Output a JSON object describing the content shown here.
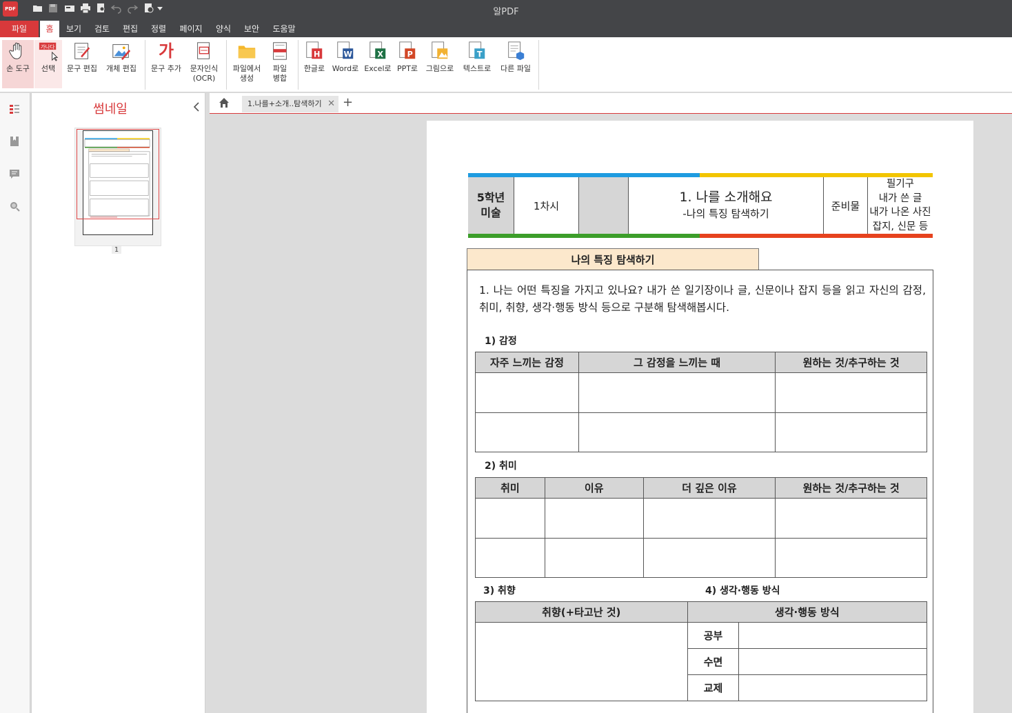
{
  "app": {
    "logo": "PDF",
    "title": "알PDF"
  },
  "menu": [
    "파일",
    "홈",
    "보기",
    "검토",
    "편집",
    "정렬",
    "페이지",
    "양식",
    "보안",
    "도움말"
  ],
  "ribbon": {
    "hand": "손 도구",
    "select": "선택",
    "select_badge": "가나다",
    "text_edit": "문구 편집",
    "object_edit": "개체 편집",
    "text_add": "문구 추가",
    "text_add_glyph": "가",
    "ocr": "문자인식",
    "ocr2": "(OCR)",
    "create": "파일에서",
    "create2": "생성",
    "merge": "파일",
    "merge2": "병합",
    "hangul": "한글로",
    "word": "Word로",
    "excel": "Excel로",
    "ppt": "PPT로",
    "image": "그림으로",
    "text": "텍스트로",
    "other": "다른 파일"
  },
  "thumbnails": {
    "title": "썸네일",
    "page_number": "1"
  },
  "tabs": {
    "doc_tab": "1.나를+소개..탐색하기",
    "close": "✕",
    "add": "+"
  },
  "doc": {
    "header": {
      "grade": "5학년",
      "subject": "미술",
      "period": "1차시",
      "title": "1. 나를 소개해요",
      "subtitle": "-나의 특징 탐색하기",
      "materials_label": "준비물",
      "materials": [
        "필기구",
        "내가 쓴 글",
        "내가 나온 사진",
        "잡지, 신문 등"
      ]
    },
    "section_title": "나의 특징 탐색하기",
    "question": "1. 나는 어떤 특징을 가지고 있나요? 내가 쓴 일기장이나 글, 신문이나 잡지 등을 읽고 자신의 감정, 취미, 취향, 생각·행동 방식 등으로 구분해 탐색해봅시다.",
    "emotion": {
      "heading": "1) 감정",
      "columns": [
        "자주 느끼는 감정",
        "그 감정을 느끼는 때",
        "원하는 것/추구하는 것"
      ]
    },
    "hobby": {
      "heading": "2) 취미",
      "columns": [
        "취미",
        "이유",
        "더 깊은 이유",
        "원하는 것/추구하는 것"
      ]
    },
    "taste": {
      "heading": "3) 취향",
      "column": "취향(+타고난 것)"
    },
    "behavior": {
      "heading": "4) 생각·행동 방식",
      "column": "생각·행동 방식",
      "rows": [
        "공부",
        "수면",
        "교제"
      ]
    }
  }
}
